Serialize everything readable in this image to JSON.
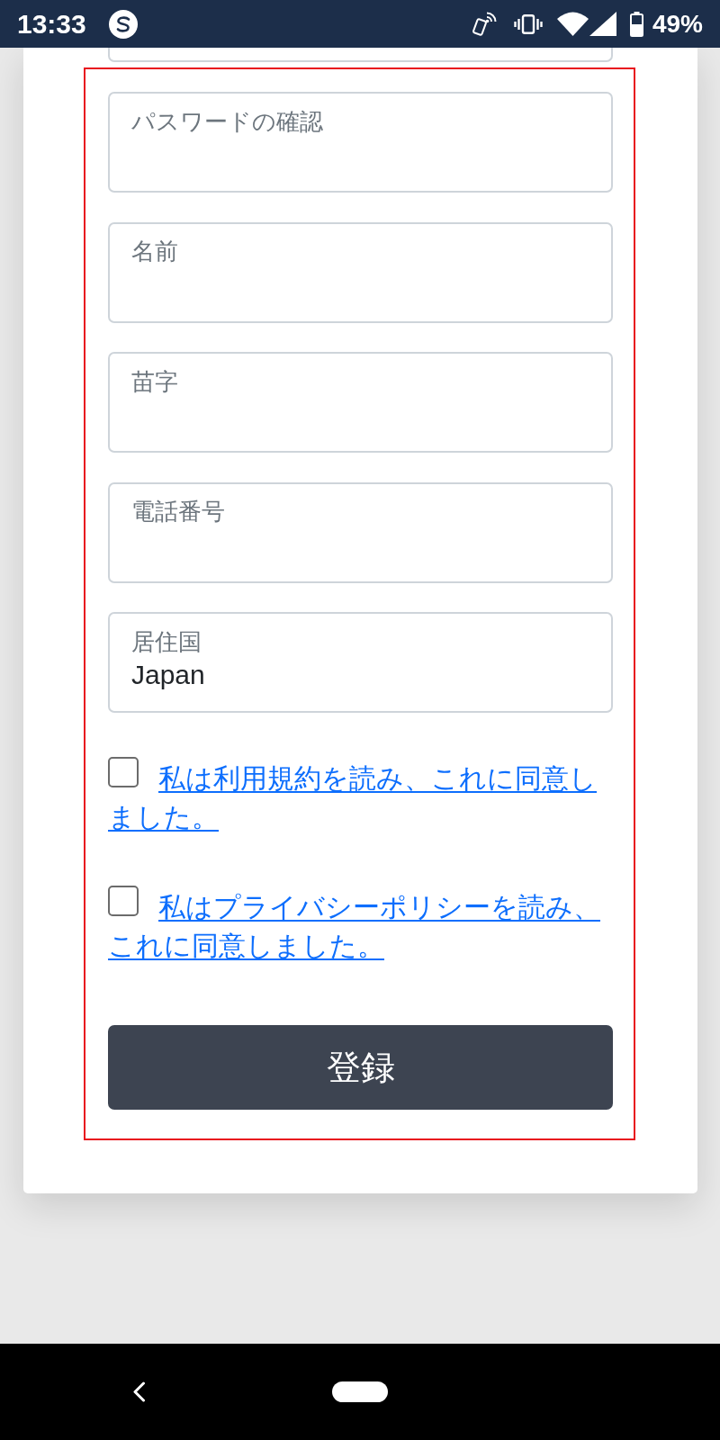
{
  "status_bar": {
    "time": "13:33",
    "battery": "49%"
  },
  "fields": [
    {
      "kind": "cut_off"
    },
    {
      "kind": "full",
      "label": "パスワードの確認"
    },
    {
      "kind": "full",
      "label": "名前"
    },
    {
      "kind": "full",
      "label": "苗字"
    },
    {
      "kind": "full",
      "label": "電話番号"
    },
    {
      "kind": "full",
      "label": "居住国",
      "value": "Japan"
    }
  ],
  "agreements": [
    {
      "text": "私は利用規約を読み、これに同意しました。",
      "checked": false
    },
    {
      "text": "私はプライバシーポリシーを読み、これに同意しました。",
      "checked": false
    }
  ],
  "submit_button": {
    "label": "登録"
  }
}
